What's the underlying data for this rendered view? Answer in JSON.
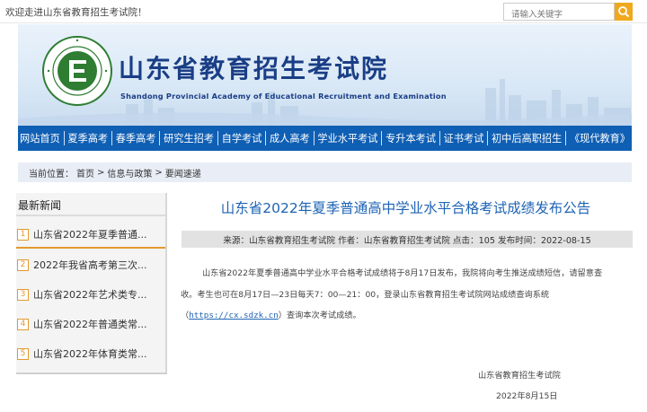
{
  "topbar": {
    "welcome": "欢迎走进山东省教育招生考试院！",
    "search_placeholder": "请输入关键字",
    "search_icon": "search-icon"
  },
  "banner": {
    "title": "山东省教育招生考试院",
    "subtitle": "Shandong Provincial Academy of Educational Recruitment and Examination",
    "seal_ring_text": "Shandong Provincial Educational Admission & Examination",
    "seal_inner_text": "山东省教育招生考试院",
    "logo_letter": "E"
  },
  "nav": {
    "items": [
      "网站首页",
      "夏季高考",
      "春季高考",
      "研究生招考",
      "自学考试",
      "成人高考",
      "学业水平考试",
      "专升本考试",
      "证书考试",
      "初中后高职招生",
      "《现代教育》"
    ]
  },
  "breadcrumb": {
    "label": "当前位置：",
    "items": [
      "首页",
      "信息与政策",
      "要闻速递"
    ],
    "separator": ">"
  },
  "sidebar": {
    "title": "最新新闻",
    "items": [
      {
        "num": "1",
        "text": "山东省2022年夏季普通..."
      },
      {
        "num": "2",
        "text": "2022年我省高考第三次..."
      },
      {
        "num": "3",
        "text": "山东省2022年艺术类专..."
      },
      {
        "num": "4",
        "text": "山东省2022年普通类常..."
      },
      {
        "num": "5",
        "text": "山东省2022年体育类常..."
      }
    ]
  },
  "article": {
    "title": "山东省2022年夏季普通高中学业水平合格考试成绩发布公告",
    "meta": "来源：山东省教育招生考试院 作者：山东省教育招生考试院 点击：105 发布时间：2022-08-15",
    "para1_line1": "山东省2022年夏季普通高中学业水平合格考试成绩将于8月17日发布，我院将向考生推送成绩短信，请留意查",
    "para1_line2": "收。考生也可在8月17日—23日每天7：00—21：00，登录山东省教育招生考试院网站成绩查询系统",
    "url_open": "（",
    "url": "https://cx.sdzk.cn",
    "url_close": "）查询本次考试成绩。",
    "sign_org": "山东省教育招生考试院",
    "sign_date": "2022年8月15日"
  },
  "colors": {
    "nav_bg": "#0f5fb4",
    "title_blue": "#1e63b4",
    "accent_orange": "#e39a2f",
    "search_btn": "#f0a81e"
  }
}
